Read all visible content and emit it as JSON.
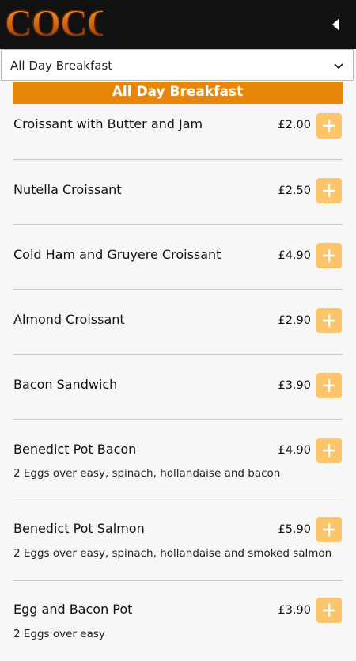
{
  "header": {
    "logo_text": "COCO",
    "back_icon": "back-triangle-icon"
  },
  "category_select": {
    "selected": "All Day Breakfast",
    "icon": "chevron-down-icon"
  },
  "section": {
    "title": "All Day Breakfast"
  },
  "items": [
    {
      "name": "Croissant with Butter and Jam",
      "price": "£2.00",
      "description": ""
    },
    {
      "name": "Nutella Croissant",
      "price": "£2.50",
      "description": ""
    },
    {
      "name": "Cold Ham and Gruyere Croissant",
      "price": "£4.90",
      "description": ""
    },
    {
      "name": "Almond Croissant",
      "price": "£2.90",
      "description": ""
    },
    {
      "name": "Bacon Sandwich",
      "price": "£3.90",
      "description": ""
    },
    {
      "name": "Benedict Pot Bacon",
      "price": "£4.90",
      "description": "2 Eggs over easy, spinach, hollandaise and bacon"
    },
    {
      "name": "Benedict Pot Salmon",
      "price": "£5.90",
      "description": "2 Eggs over easy, spinach, hollandaise and smoked salmon"
    },
    {
      "name": "Egg and Bacon Pot",
      "price": "£3.90",
      "description": "2 Eggs over easy"
    }
  ],
  "colors": {
    "accent": "#e8860a",
    "add_button": "#fcc46b",
    "topbar": "#111111"
  }
}
